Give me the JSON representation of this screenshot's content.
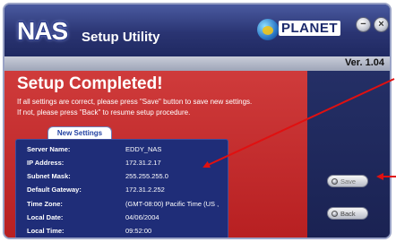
{
  "header": {
    "logo_text": "NAS",
    "app_title": "Setup Utility",
    "brand_text": "PLANET",
    "minimize_glyph": "−",
    "close_glyph": "×"
  },
  "version": "Ver. 1.04",
  "main": {
    "title": "Setup Completed!",
    "instruction_1": "If all settings are correct, please press \"Save\" button to save new settings.",
    "instruction_2": "If not, please press \"Back\" to resume setup procedure.",
    "settings_tab": "New Settings",
    "settings": [
      {
        "label": "Server Name:",
        "value": "EDDY_NAS"
      },
      {
        "label": "IP Address:",
        "value": "172.31.2.17"
      },
      {
        "label": "Subnet Mask:",
        "value": "255.255.255.0"
      },
      {
        "label": "Default Gateway:",
        "value": "172.31.2.252"
      },
      {
        "label": "Time Zone:",
        "value": "(GMT-08:00) Pacific Time (US ,"
      },
      {
        "label": "Local Date:",
        "value": "04/06/2004"
      },
      {
        "label": "Local Time:",
        "value": "09:52:00"
      }
    ]
  },
  "side": {
    "save_label": "Save",
    "back_label": "Back"
  },
  "colors": {
    "main_panel": "#b71f21",
    "annotation_arrow": "#e01010",
    "window_bg": "#1d2756"
  },
  "icons": [
    "nas-logo",
    "planet-globe-icon",
    "minimize-icon",
    "close-icon",
    "button-dot-icon"
  ]
}
